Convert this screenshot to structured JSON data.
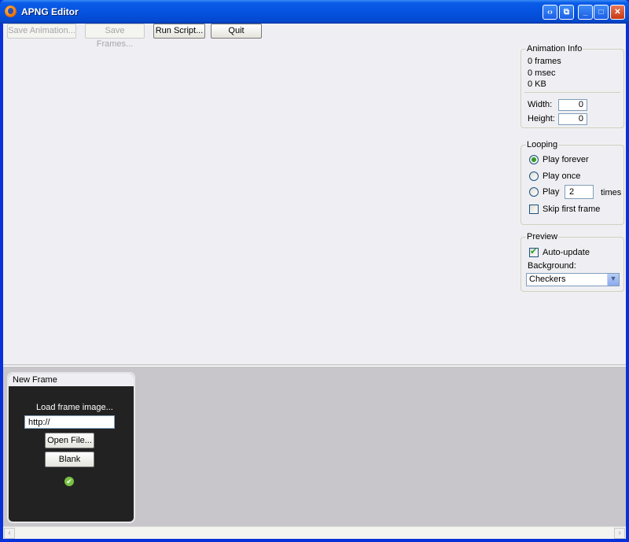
{
  "window": {
    "title": "APNG Editor"
  },
  "toolbar": {
    "save_animation": "Save Animation...",
    "save_frames": "Save Frames...",
    "run_script": "Run Script...",
    "quit": "Quit"
  },
  "animation_info": {
    "title": "Animation Info",
    "frames": "0 frames",
    "duration": "0 msec",
    "size": "0 KB",
    "width_label": "Width:",
    "width_value": "0",
    "height_label": "Height:",
    "height_value": "0"
  },
  "looping": {
    "title": "Looping",
    "play_forever": "Play forever",
    "play_once": "Play once",
    "play": "Play",
    "play_count": "2",
    "times": "times",
    "skip_first": "Skip first frame",
    "selected": "Play forever"
  },
  "preview": {
    "title": "Preview",
    "auto_update": "Auto-update",
    "auto_update_checked": true,
    "background_label": "Background:",
    "background_value": "Checkers"
  },
  "new_frame": {
    "title": "New Frame",
    "load_label": "Load frame image...",
    "url_value": "http://",
    "open_file": "Open File...",
    "blank": "Blank"
  },
  "colors": {
    "accent": "#0553e0",
    "ok_icon": "#7ac143"
  }
}
